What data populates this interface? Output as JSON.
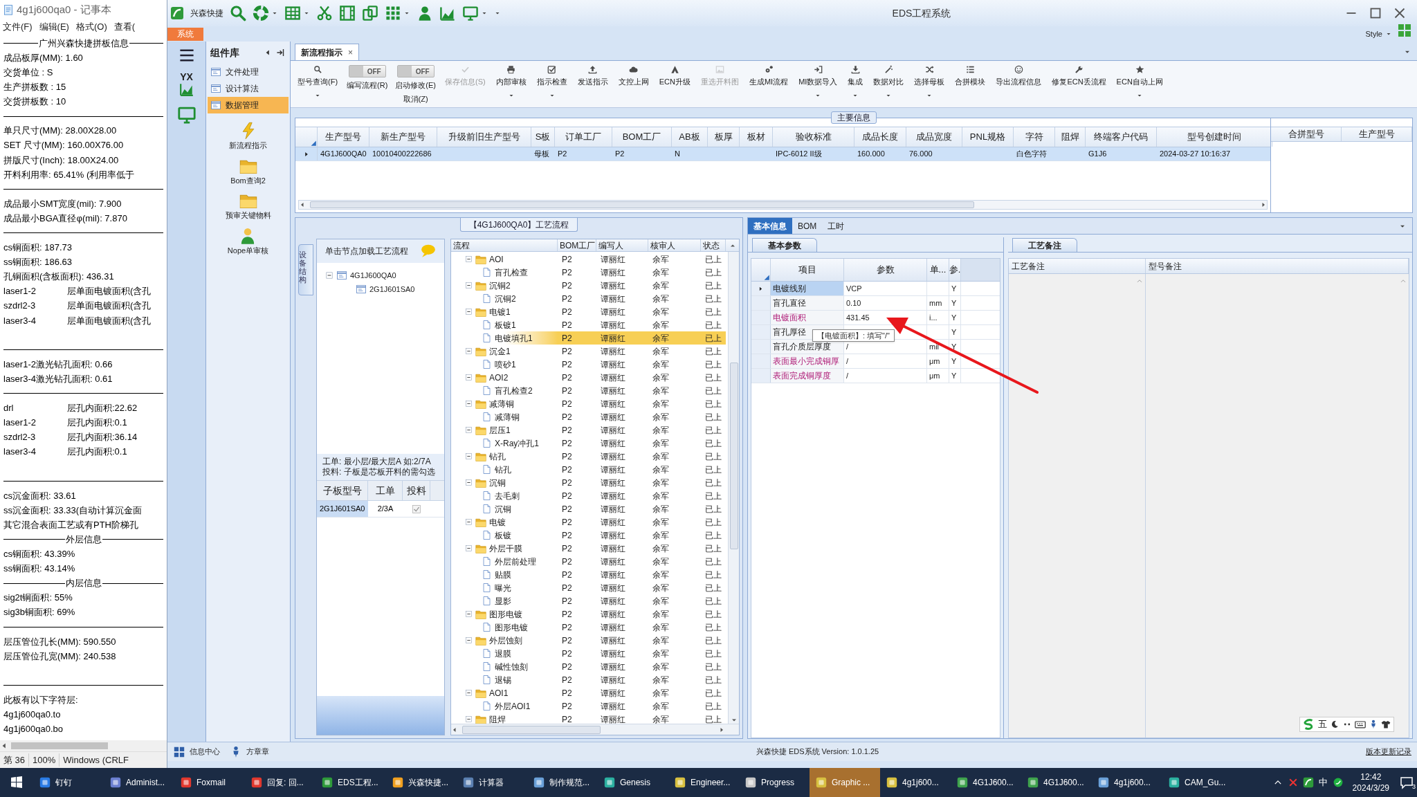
{
  "notepad": {
    "title": "4g1j600qa0 - 记事本",
    "menu": [
      "文件(F)",
      "编辑(E)",
      "格式(O)",
      "查看("
    ],
    "lines": [
      {
        "kind": "heading",
        "text": "广州兴森快捷拼板信息"
      },
      {
        "kind": "text",
        "text": "成品板厚(MM): 1.60"
      },
      {
        "kind": "text",
        "text": "交货单位 : S"
      },
      {
        "kind": "text",
        "text": "生产拼板数 : 15"
      },
      {
        "kind": "text",
        "text": "交货拼板数 : 10"
      },
      {
        "kind": "rule"
      },
      {
        "kind": "text",
        "text": "单只尺寸(MM): 28.00X28.00"
      },
      {
        "kind": "text",
        "text": "SET 尺寸(MM): 160.00X76.00"
      },
      {
        "kind": "text",
        "text": "拼版尺寸(Inch): 18.00X24.00"
      },
      {
        "kind": "text",
        "text": "开料利用率: 65.41% (利用率低于"
      },
      {
        "kind": "rule"
      },
      {
        "kind": "text",
        "text": "成品最小SMT宽度(mil): 7.900"
      },
      {
        "kind": "text",
        "text": "成品最小BGA直径φ(mil):  7.870"
      },
      {
        "kind": "rule"
      },
      {
        "kind": "text",
        "text": "cs铜面积: 187.73"
      },
      {
        "kind": "text",
        "text": "ss铜面积: 186.63"
      },
      {
        "kind": "text",
        "text": "孔铜面积(含板面积): 436.31"
      },
      {
        "kind": "tabbed",
        "left": "laser1-2",
        "right": "层单面电镀面积(含孔"
      },
      {
        "kind": "tabbed",
        "left": "szdrl2-3",
        "right": "层单面电镀面积(含孔"
      },
      {
        "kind": "tabbed",
        "left": "laser3-4",
        "right": "层单面电镀面积(含孔"
      },
      {
        "kind": "blank"
      },
      {
        "kind": "rule"
      },
      {
        "kind": "text",
        "text": "laser1-2激光钻孔面积: 0.66"
      },
      {
        "kind": "text",
        "text": "laser3-4激光钻孔面积: 0.61"
      },
      {
        "kind": "rule"
      },
      {
        "kind": "tabbed",
        "left": "drl",
        "right": "层孔内面积:22.62"
      },
      {
        "kind": "tabbed",
        "left": "laser1-2",
        "right": "层孔内面积:0.1"
      },
      {
        "kind": "tabbed",
        "left": "szdrl2-3",
        "right": "层孔内面积:36.14"
      },
      {
        "kind": "tabbed",
        "left": "laser3-4",
        "right": "层孔内面积:0.1"
      },
      {
        "kind": "blank"
      },
      {
        "kind": "rule"
      },
      {
        "kind": "text",
        "text": "cs沉金面积: 33.61"
      },
      {
        "kind": "text",
        "text": "ss沉金面积: 33.33(自动计算沉金面"
      },
      {
        "kind": "text",
        "text": "其它混合表面工艺或有PTH阶梯孔"
      },
      {
        "kind": "heading",
        "text": "外层信息"
      },
      {
        "kind": "text",
        "text": "cs铜面积: 43.39%"
      },
      {
        "kind": "text",
        "text": "ss铜面积: 43.14%"
      },
      {
        "kind": "heading",
        "text": "内层信息"
      },
      {
        "kind": "text",
        "text": "sig2t铜面积: 55%"
      },
      {
        "kind": "text",
        "text": "sig3b铜面积: 69%"
      },
      {
        "kind": "rule"
      },
      {
        "kind": "text",
        "text": "层压管位孔长(MM): 590.550"
      },
      {
        "kind": "text",
        "text": "层压管位孔宽(MM): 240.538"
      },
      {
        "kind": "blank"
      },
      {
        "kind": "rule"
      },
      {
        "kind": "text",
        "text": "此板有以下字符层:"
      },
      {
        "kind": "text",
        "text": "4g1j600qa0.to"
      },
      {
        "kind": "text",
        "text": "4g1j600qa0.bo"
      }
    ],
    "status": [
      "第 36",
      "100%",
      "Windows (CRLF"
    ]
  },
  "app": {
    "name": "兴森快捷",
    "title": "EDS工程系统",
    "ribbon_tab": "系统",
    "style_menu": "Style",
    "rail_badge": "YX"
  },
  "sidebar": {
    "title": "组件库",
    "nav": [
      {
        "label": "文件处理",
        "selected": false
      },
      {
        "label": "设计算法",
        "selected": false
      },
      {
        "label": "数据管理",
        "selected": true
      }
    ],
    "launchers": [
      {
        "label": "新流程指示"
      },
      {
        "label": "Bom查询2"
      },
      {
        "label": "预审关键物料"
      },
      {
        "label": "Nope单审核"
      }
    ]
  },
  "doc_tab": {
    "label": "新流程指示",
    "close": "×"
  },
  "toolbar": [
    {
      "kind": "button",
      "label": "型号查询(F)",
      "disabled": false,
      "dropdown": true
    },
    {
      "kind": "toggle",
      "label": "编写流程(R)",
      "switch_text": "OFF",
      "on": false
    },
    {
      "kind": "toggle",
      "label": "启动修改(E)",
      "sublabel": "取消(Z)",
      "switch_text": "OFF",
      "on": false
    },
    {
      "kind": "button",
      "label": "保存信息(S)",
      "disabled": true,
      "dropdown": false
    },
    {
      "kind": "button",
      "label": "内部审核",
      "disabled": false,
      "dropdown": true
    },
    {
      "kind": "button",
      "label": "指示检查",
      "disabled": false,
      "dropdown": true
    },
    {
      "kind": "button",
      "label": "发送指示",
      "disabled": false,
      "dropdown": false
    },
    {
      "kind": "button",
      "label": "文控上网",
      "disabled": false,
      "dropdown": false
    },
    {
      "kind": "button",
      "label": "ECN升级",
      "disabled": false,
      "dropdown": false
    },
    {
      "kind": "button",
      "label": "重选开料图",
      "disabled": true,
      "dropdown": false
    },
    {
      "kind": "button",
      "label": "生成MI流程",
      "disabled": false,
      "dropdown": false
    },
    {
      "kind": "button",
      "label": "MI数据导入",
      "disabled": false,
      "dropdown": true
    },
    {
      "kind": "button",
      "label": "集成",
      "disabled": false,
      "dropdown": true
    },
    {
      "kind": "button",
      "label": "数据对比",
      "disabled": false,
      "dropdown": true
    },
    {
      "kind": "button",
      "label": "选择母板",
      "disabled": false,
      "dropdown": true
    },
    {
      "kind": "button",
      "label": "合拼模块",
      "disabled": false,
      "dropdown": false
    },
    {
      "kind": "button",
      "label": "导出流程信息",
      "disabled": false,
      "dropdown": false
    },
    {
      "kind": "button",
      "label": "修复ECN丢流程",
      "disabled": false,
      "dropdown": false
    },
    {
      "kind": "button",
      "label": "ECN自动上网",
      "disabled": false,
      "dropdown": true
    }
  ],
  "main_info": {
    "title": "主要信息",
    "columns": [
      "生产型号",
      "新生产型号",
      "升级前旧生产型号",
      "S板",
      "订单工厂",
      "BOM工厂",
      "AB板",
      "板厚",
      "板材",
      "验收标准",
      "成品长度",
      "成品宽度",
      "PNL规格",
      "字符",
      "阻焊",
      "终端客户代码",
      "型号创建时间"
    ],
    "rows": [
      {
        "selected": true,
        "cells": [
          "4G1J600QA0",
          "10010400222686",
          null,
          "母板",
          "P2",
          "P2",
          "N",
          null,
          null,
          "IPC-6012 II级",
          "160.000",
          "76.000",
          null,
          "白色字符",
          null,
          "G1J6",
          "2024-03-27 10:16:37"
        ]
      }
    ],
    "side_columns": [
      "合拼型号",
      "生产型号"
    ]
  },
  "process": {
    "title": "【4G1J600QA0】工艺流程",
    "side_tab": "设备结构",
    "hint": "单击节点加载工艺流程",
    "tree": [
      {
        "label": "4G1J600QA0",
        "expanded": true,
        "children": [
          {
            "label": "2G1J601SA0"
          }
        ]
      }
    ],
    "notes": [
      "工单: 最小层/最大层A 如:2/7A",
      "投料: 子板是芯板开料的需勾选"
    ],
    "sub_columns": [
      "子板型号",
      "工单",
      "投料"
    ],
    "sub_rows": [
      {
        "model": "2G1J601SA0",
        "order": "2/3A",
        "fed": true
      }
    ],
    "columns": [
      "流程",
      "BOM工厂",
      "编写人",
      "核审人",
      "状态"
    ],
    "steps": [
      {
        "name": "AOI",
        "bom": "P2",
        "writer": "谭丽红",
        "reviewer": "余军",
        "status": "已上",
        "expanded": true,
        "children": [
          {
            "name": "盲孔检查",
            "bom": "P2",
            "writer": "谭丽红",
            "reviewer": "余军",
            "status": "已上",
            "selected": false
          }
        ]
      },
      {
        "name": "沉铜2",
        "bom": "P2",
        "writer": "谭丽红",
        "reviewer": "余军",
        "status": "已上",
        "expanded": true,
        "children": [
          {
            "name": "沉铜2",
            "bom": "P2",
            "writer": "谭丽红",
            "reviewer": "余军",
            "status": "已上",
            "selected": false
          }
        ]
      },
      {
        "name": "电镀1",
        "bom": "P2",
        "writer": "谭丽红",
        "reviewer": "余军",
        "status": "已上",
        "expanded": true,
        "children": [
          {
            "name": "板镀1",
            "bom": "P2",
            "writer": "谭丽红",
            "reviewer": "余军",
            "status": "已上",
            "selected": false
          },
          {
            "name": "电镀填孔1",
            "bom": "P2",
            "writer": "谭丽红",
            "reviewer": "余军",
            "status": "已上",
            "selected": true
          }
        ]
      },
      {
        "name": "沉金1",
        "bom": "P2",
        "writer": "谭丽红",
        "reviewer": "余军",
        "status": "已上",
        "expanded": true,
        "children": [
          {
            "name": "喷砂1",
            "bom": "P2",
            "writer": "谭丽红",
            "reviewer": "余军",
            "status": "已上",
            "selected": false
          }
        ]
      },
      {
        "name": "AOI2",
        "bom": "P2",
        "writer": "谭丽红",
        "reviewer": "余军",
        "status": "已上",
        "expanded": true,
        "children": [
          {
            "name": "盲孔检查2",
            "bom": "P2",
            "writer": "谭丽红",
            "reviewer": "余军",
            "status": "已上",
            "selected": false
          }
        ]
      },
      {
        "name": "减薄铜",
        "bom": "P2",
        "writer": "谭丽红",
        "reviewer": "余军",
        "status": "已上",
        "expanded": true,
        "children": [
          {
            "name": "减薄铜",
            "bom": "P2",
            "writer": "谭丽红",
            "reviewer": "余军",
            "status": "已上",
            "selected": false
          }
        ]
      },
      {
        "name": "层压1",
        "bom": "P2",
        "writer": "谭丽红",
        "reviewer": "余军",
        "status": "已上",
        "expanded": true,
        "children": [
          {
            "name": "X-Ray冲孔1",
            "bom": "P2",
            "writer": "谭丽红",
            "reviewer": "余军",
            "status": "已上",
            "selected": false
          }
        ]
      },
      {
        "name": "钻孔",
        "bom": "P2",
        "writer": "谭丽红",
        "reviewer": "余军",
        "status": "已上",
        "expanded": true,
        "children": [
          {
            "name": "钻孔",
            "bom": "P2",
            "writer": "谭丽红",
            "reviewer": "余军",
            "status": "已上",
            "selected": false
          }
        ]
      },
      {
        "name": "沉铜",
        "bom": "P2",
        "writer": "谭丽红",
        "reviewer": "余军",
        "status": "已上",
        "expanded": true,
        "children": [
          {
            "name": "去毛刺",
            "bom": "P2",
            "writer": "谭丽红",
            "reviewer": "余军",
            "status": "已上",
            "selected": false
          },
          {
            "name": "沉铜",
            "bom": "P2",
            "writer": "谭丽红",
            "reviewer": "余军",
            "status": "已上",
            "selected": false
          }
        ]
      },
      {
        "name": "电镀",
        "bom": "P2",
        "writer": "谭丽红",
        "reviewer": "余军",
        "status": "已上",
        "expanded": true,
        "children": [
          {
            "name": "板镀",
            "bom": "P2",
            "writer": "谭丽红",
            "reviewer": "余军",
            "status": "已上",
            "selected": false
          }
        ]
      },
      {
        "name": "外层干膜",
        "bom": "P2",
        "writer": "谭丽红",
        "reviewer": "余军",
        "status": "已上",
        "expanded": true,
        "children": [
          {
            "name": "外层前处理",
            "bom": "P2",
            "writer": "谭丽红",
            "reviewer": "余军",
            "status": "已上",
            "selected": false
          },
          {
            "name": "贴膜",
            "bom": "P2",
            "writer": "谭丽红",
            "reviewer": "余军",
            "status": "已上",
            "selected": false
          },
          {
            "name": "曝光",
            "bom": "P2",
            "writer": "谭丽红",
            "reviewer": "余军",
            "status": "已上",
            "selected": false
          },
          {
            "name": "显影",
            "bom": "P2",
            "writer": "谭丽红",
            "reviewer": "余军",
            "status": "已上",
            "selected": false
          }
        ]
      },
      {
        "name": "图形电镀",
        "bom": "P2",
        "writer": "谭丽红",
        "reviewer": "余军",
        "status": "已上",
        "expanded": true,
        "children": [
          {
            "name": "图形电镀",
            "bom": "P2",
            "writer": "谭丽红",
            "reviewer": "余军",
            "status": "已上",
            "selected": false
          }
        ]
      },
      {
        "name": "外层蚀刻",
        "bom": "P2",
        "writer": "谭丽红",
        "reviewer": "余军",
        "status": "已上",
        "expanded": true,
        "children": [
          {
            "name": "退膜",
            "bom": "P2",
            "writer": "谭丽红",
            "reviewer": "余军",
            "status": "已上",
            "selected": false
          },
          {
            "name": "碱性蚀刻",
            "bom": "P2",
            "writer": "谭丽红",
            "reviewer": "余军",
            "status": "已上",
            "selected": false
          },
          {
            "name": "退锡",
            "bom": "P2",
            "writer": "谭丽红",
            "reviewer": "余军",
            "status": "已上",
            "selected": false
          }
        ]
      },
      {
        "name": "AOI1",
        "bom": "P2",
        "writer": "谭丽红",
        "reviewer": "余军",
        "status": "已上",
        "expanded": true,
        "children": [
          {
            "name": "外层AOI1",
            "bom": "P2",
            "writer": "谭丽红",
            "reviewer": "余军",
            "status": "已上",
            "selected": false
          }
        ]
      },
      {
        "name": "阻焊",
        "bom": "P2",
        "writer": "谭丽红",
        "reviewer": "余军",
        "status": "已上",
        "expanded": true
      }
    ]
  },
  "details": {
    "tabs": [
      {
        "label": "基本信息",
        "selected": true
      },
      {
        "label": "BOM",
        "selected": false
      },
      {
        "label": "工时",
        "selected": false
      }
    ],
    "param_tab": "基本参数",
    "param_columns": [
      "项目",
      "参数",
      "单...",
      "参."
    ],
    "params": [
      {
        "item": "电镀线别",
        "value": "VCP",
        "flag": "Y",
        "required": false,
        "selected": true
      },
      {
        "item": "盲孔直径",
        "value": "0.10",
        "unit": "mm",
        "flag": "Y",
        "required": false,
        "selected": false
      },
      {
        "item": "电镀面积",
        "value": "431.45",
        "unit": "i...",
        "flag": "Y",
        "required": true,
        "selected": false
      },
      {
        "item": "盲孔厚径",
        "flag": "Y",
        "required": false,
        "selected": false
      },
      {
        "item": "盲孔介质层厚度",
        "value": "/",
        "unit": "mil",
        "flag": "Y",
        "required": false,
        "selected": false
      },
      {
        "item": "表面最小完成铜厚",
        "value": "/",
        "unit": "μm",
        "flag": "Y",
        "required": true,
        "selected": false
      },
      {
        "item": "表面完成铜厚度",
        "value": "/",
        "unit": "μm",
        "flag": "Y",
        "required": true,
        "selected": false
      }
    ],
    "tooltip": "【电镀面积】: 填写\"/\"",
    "notes_tab": "工艺备注",
    "notes_columns": [
      "工艺备注",
      "型号备注"
    ]
  },
  "status_bar": {
    "left": [
      "信息中心",
      "方章章"
    ],
    "center": "兴森快捷 EDS系统 Version: 1.0.1.25",
    "link": "版本更新记录"
  },
  "ime_bar": {
    "label": "五"
  },
  "taskbar": {
    "items": [
      {
        "label": "钉钉",
        "selected": false
      },
      {
        "label": "Administ...",
        "selected": false
      },
      {
        "label": "Foxmail",
        "selected": false
      },
      {
        "label": "回复: 回...",
        "selected": false
      },
      {
        "label": "EDS工程...",
        "selected": false
      },
      {
        "label": "兴森快捷...",
        "selected": false
      },
      {
        "label": "计算器",
        "selected": false
      },
      {
        "label": "制作规范...",
        "selected": false
      },
      {
        "label": "Genesis",
        "selected": false
      },
      {
        "label": "Engineer...",
        "selected": false
      },
      {
        "label": "Progress",
        "selected": false
      },
      {
        "label": "Graphic ...",
        "selected": true
      },
      {
        "label": "4g1j600...",
        "selected": false
      },
      {
        "label": "4G1J600...",
        "selected": false
      },
      {
        "label": "4G1J600...",
        "selected": false
      },
      {
        "label": "4g1j600...",
        "selected": false
      },
      {
        "label": "CAM_Gu...",
        "selected": false
      }
    ],
    "tray": {
      "ime": "中",
      "time": "12:42",
      "date": "2024/3/29",
      "notifications": "3"
    }
  }
}
